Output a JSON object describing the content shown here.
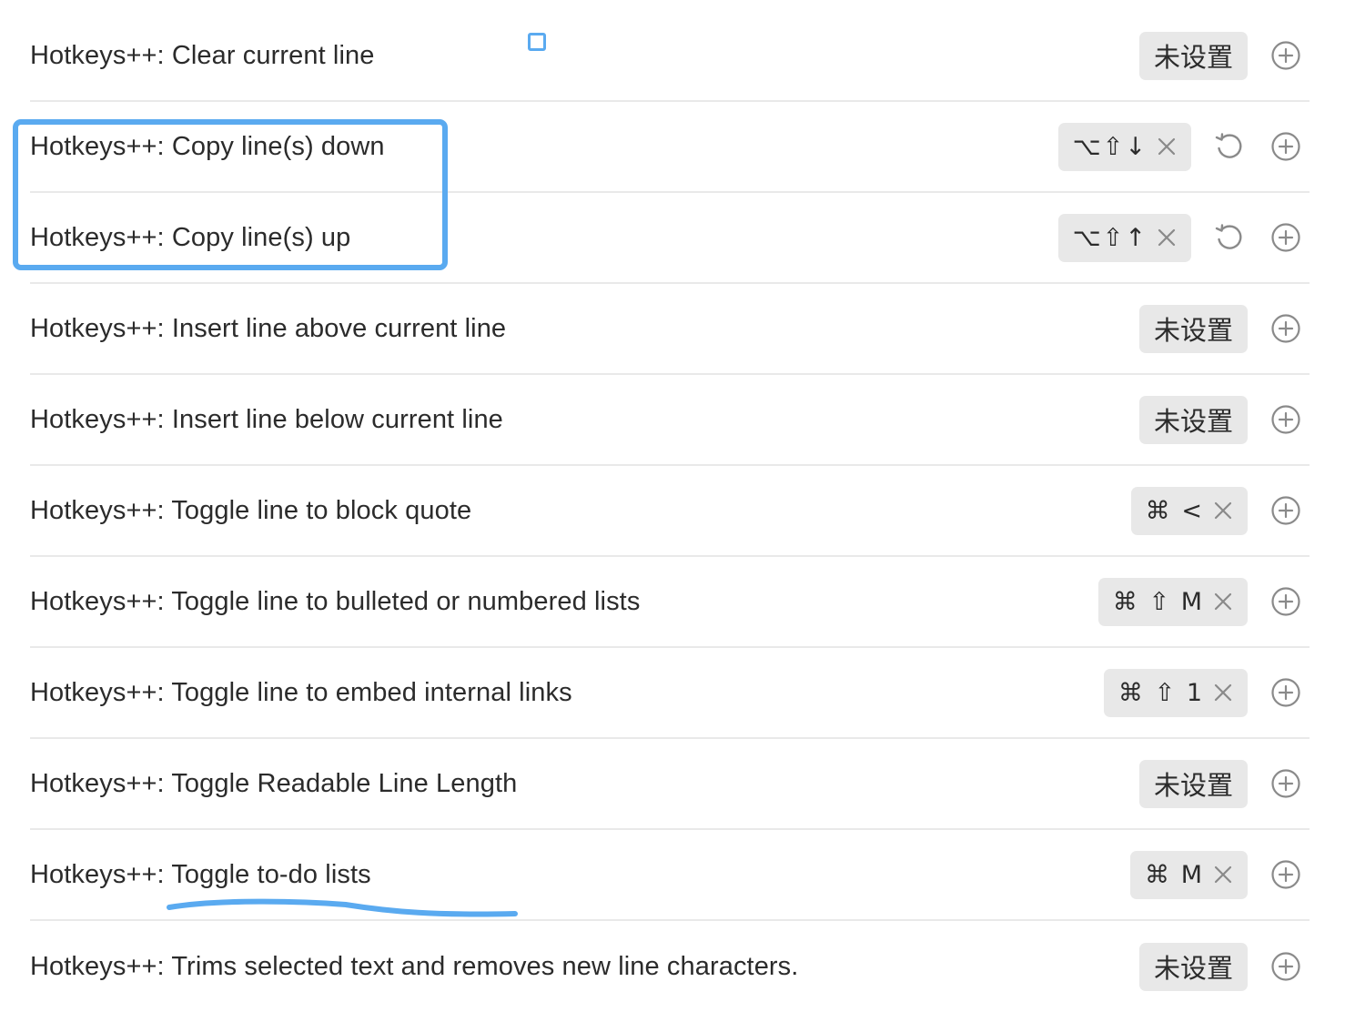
{
  "commands": [
    {
      "name": "Hotkeys++: Clear current line",
      "hotkey": null,
      "unset_label": "未设置",
      "has_reset": false
    },
    {
      "name": "Hotkeys++: Copy line(s) down",
      "hotkey": "⌥⇧↓",
      "unset_label": null,
      "has_reset": true
    },
    {
      "name": "Hotkeys++: Copy line(s) up",
      "hotkey": "⌥⇧↑",
      "unset_label": null,
      "has_reset": true
    },
    {
      "name": "Hotkeys++: Insert line above current line",
      "hotkey": null,
      "unset_label": "未设置",
      "has_reset": false
    },
    {
      "name": "Hotkeys++: Insert line below current line",
      "hotkey": null,
      "unset_label": "未设置",
      "has_reset": false
    },
    {
      "name": "Hotkeys++: Toggle line to block quote",
      "hotkey": "⌘ <",
      "unset_label": null,
      "has_reset": false
    },
    {
      "name": "Hotkeys++: Toggle line to bulleted or numbered lists",
      "hotkey": "⌘ ⇧ M",
      "unset_label": null,
      "has_reset": false
    },
    {
      "name": "Hotkeys++: Toggle line to embed internal links",
      "hotkey": "⌘ ⇧ 1",
      "unset_label": null,
      "has_reset": false
    },
    {
      "name": "Hotkeys++: Toggle Readable Line Length",
      "hotkey": null,
      "unset_label": "未设置",
      "has_reset": false
    },
    {
      "name": "Hotkeys++: Toggle to-do lists",
      "hotkey": "⌘ M",
      "unset_label": null,
      "has_reset": false
    },
    {
      "name": "Hotkeys++: Trims selected text and removes new line characters.",
      "hotkey": null,
      "unset_label": "未设置",
      "has_reset": false
    }
  ],
  "icons": {
    "remove_hotkey": "close-icon",
    "reset_hotkey": "reset-icon",
    "add_hotkey": "plus-circle-icon"
  },
  "colors": {
    "annotation": "#5aaaf0",
    "badge_bg": "#e8e8e8",
    "divider": "#e9e9e9",
    "icon": "#8a8a8a"
  }
}
